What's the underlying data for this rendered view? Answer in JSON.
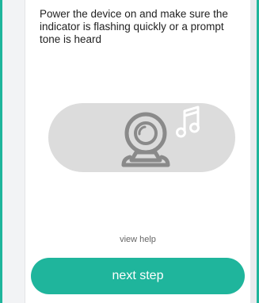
{
  "instruction": {
    "text": "Power the device on and make sure the indicator is flashing quickly or a prompt tone is heard"
  },
  "illustration": {
    "device_icon": "camera-icon",
    "sound_icon": "music-note-icon"
  },
  "help": {
    "label": "view help"
  },
  "actions": {
    "next_label": "next step"
  },
  "colors": {
    "accent": "#1fb59c",
    "pill_background": "#dcdcdc",
    "icon_gray": "#8a8a8a",
    "icon_white": "#ffffff"
  }
}
